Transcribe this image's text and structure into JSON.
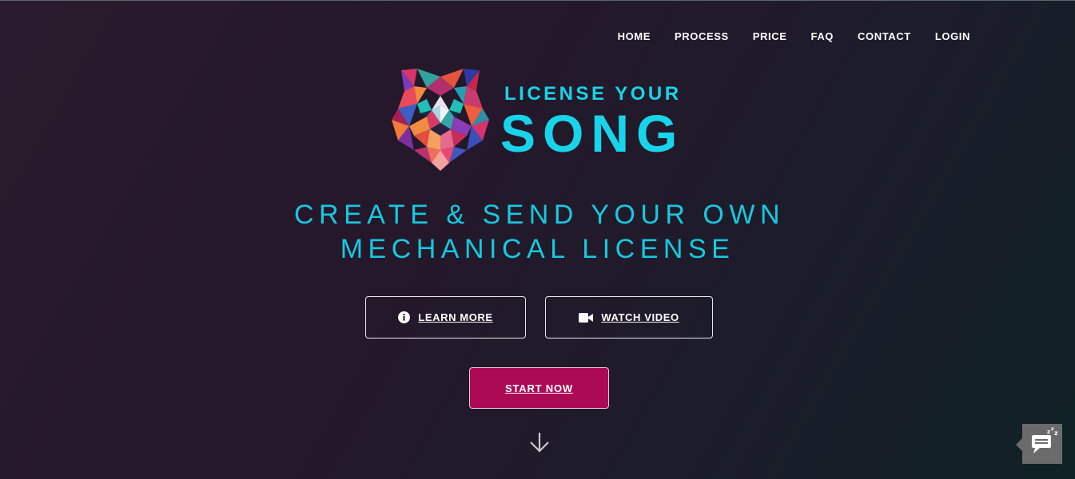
{
  "nav": {
    "items": [
      {
        "label": "HOME"
      },
      {
        "label": "PROCESS"
      },
      {
        "label": "PRICE"
      },
      {
        "label": "FAQ"
      },
      {
        "label": "CONTACT"
      },
      {
        "label": "LOGIN"
      }
    ]
  },
  "logo": {
    "line1": "LICENSE YOUR",
    "line2": "SONG",
    "icon": "geometric-tiger-icon"
  },
  "hero": {
    "headline_line1": "CREATE & SEND YOUR OWN",
    "headline_line2": "MECHANICAL LICENSE"
  },
  "buttons": {
    "learn_more": "LEARN MORE",
    "watch_video": "WATCH VIDEO",
    "start_now": "START NOW"
  },
  "icons": {
    "learn_more": "info-icon",
    "watch_video": "video-camera-icon",
    "scroll": "arrow-down-icon",
    "chat": "chat-sleep-icon"
  },
  "colors": {
    "accent": "#18d4ea",
    "cta": "#ad0a55",
    "background_start": "#2a1a2d",
    "background_end": "#0f2226"
  }
}
